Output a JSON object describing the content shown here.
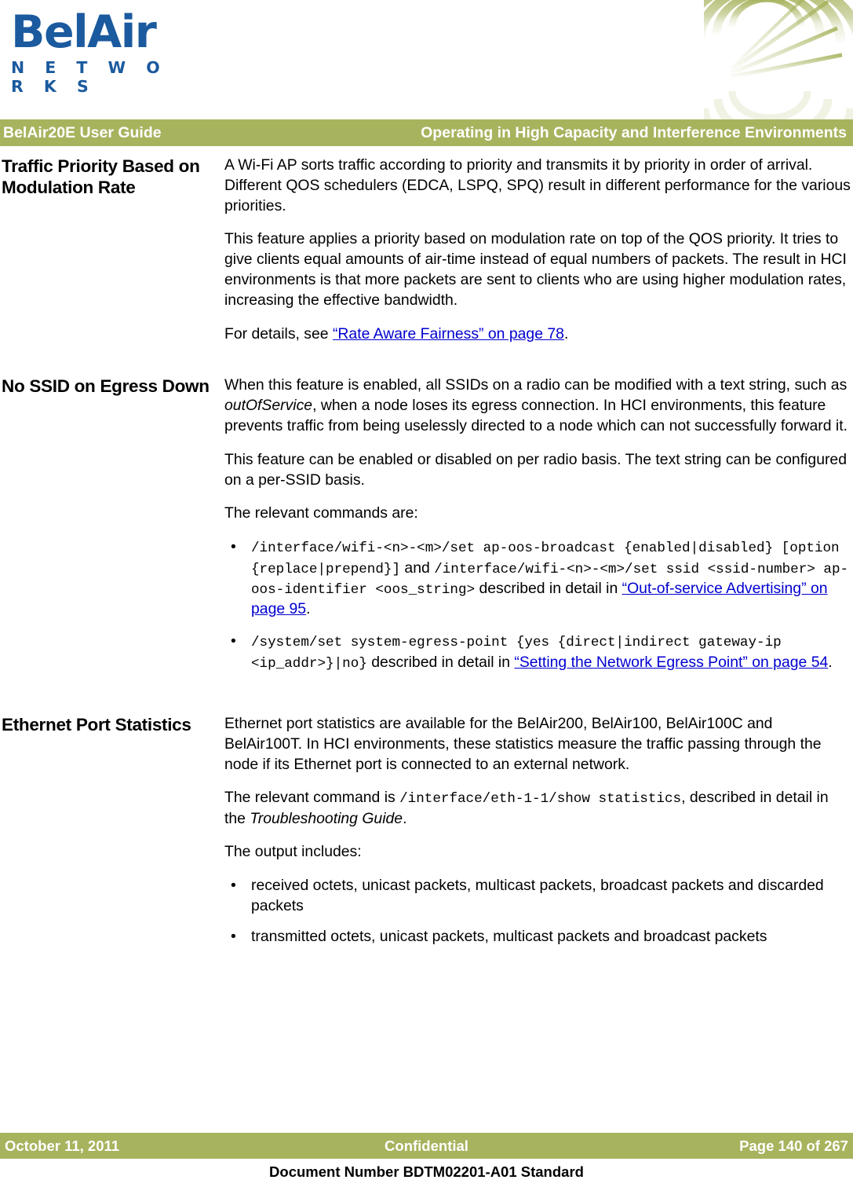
{
  "brand": {
    "logo_word": "BelAir",
    "logo_subtitle": "N E T W O R K S",
    "logo_color": "#1b5a9e",
    "accent_color": "#a8b35e",
    "link_color": "#0000d0"
  },
  "header": {
    "left": "BelAir20E User Guide",
    "right": "Operating in High Capacity and Interference Environments"
  },
  "sections": [
    {
      "heading": "Traffic Priority Based on Modulation Rate",
      "paragraphs": [
        "A Wi-Fi AP sorts traffic according to priority and transmits it by priority in order of arrival. Different QOS schedulers (EDCA, LSPQ, SPQ) result in different performance for the various priorities.",
        "This feature applies a priority based on modulation rate on top of the QOS priority. It tries to give clients equal amounts of air-time instead of equal numbers of packets. The result in HCI environments is that more packets are sent to clients who are using higher modulation rates, increasing the effective bandwidth."
      ],
      "details_prefix": "For details, see ",
      "details_link": "“Rate Aware Fairness” on page 78",
      "details_suffix": "."
    },
    {
      "heading": "No SSID on Egress Down",
      "para1_a": "When this feature is enabled, all SSIDs on a radio can be modified with a text string, such as ",
      "para1_italic": "outOfService",
      "para1_b": ", when a node loses its egress connection. In HCI environments, this feature prevents traffic from being uselessly directed to a node which can not successfully forward it.",
      "para2": "This feature can be enabled or disabled on per radio basis. The text string can be configured on a per-SSID basis.",
      "para3": "The relevant commands are:",
      "bullets": [
        {
          "code_1": "/interface/wifi-<n>-<m>/set ap-oos-broadcast {enabled|disabled} [option {replace|prepend}]",
          "mid_1": " and ",
          "code_2": "/interface/wifi-<n>-<m>/set ssid <ssid-number> ap-oos-identifier <oos_string>",
          "mid_2": " described in detail in ",
          "link": "“Out-of-service Advertising” on page 95",
          "tail": "."
        },
        {
          "code_1": "/system/set system-egress-point {yes {direct|indirect gateway-ip <ip_addr>}|no}",
          "mid_1": "",
          "code_2": "",
          "mid_2": " described in detail in ",
          "link": "“Setting the Network Egress Point” on page 54",
          "tail": "."
        }
      ]
    },
    {
      "heading": "Ethernet Port Statistics",
      "para1": "Ethernet port statistics are available for the BelAir200, BelAir100, BelAir100C and BelAir100T. In HCI environments, these statistics measure the traffic passing through the node if its Ethernet port is connected to an external network.",
      "para2_a": "The relevant command is ",
      "para2_code": "/interface/eth-1-1/show statistics",
      "para2_b": ", described in detail in the ",
      "para2_italic": "Troubleshooting Guide",
      "para2_c": ".",
      "para3": "The output includes:",
      "bullets": [
        "received octets, unicast packets, multicast packets, broadcast packets and discarded packets",
        "transmitted octets, unicast packets, multicast packets and broadcast packets"
      ]
    }
  ],
  "bullet_glyph": "•",
  "footer": {
    "date": "October 11, 2011",
    "classification": "Confidential",
    "page": "Page 140 of 267",
    "document_number": "Document Number BDTM02201-A01 Standard"
  }
}
